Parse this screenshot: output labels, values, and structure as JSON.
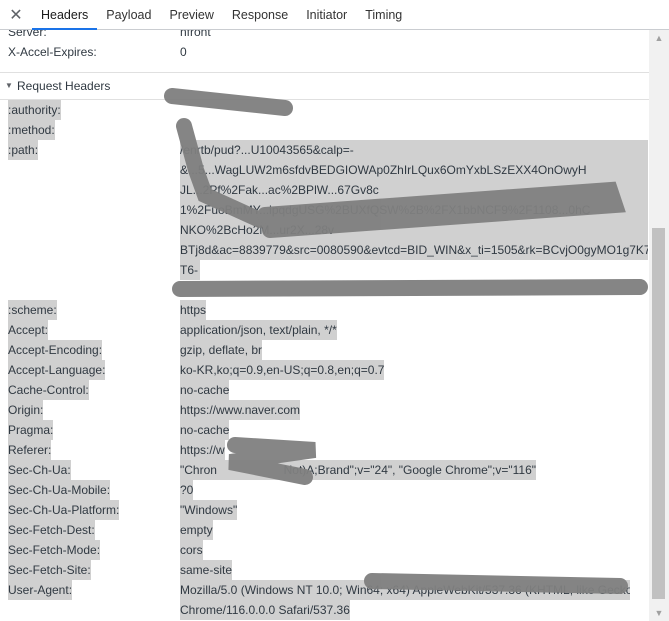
{
  "tabs": {
    "close": "✕",
    "items": [
      {
        "label": "Headers",
        "active": true
      },
      {
        "label": "Payload",
        "active": false
      },
      {
        "label": "Preview",
        "active": false
      },
      {
        "label": "Response",
        "active": false
      },
      {
        "label": "Initiator",
        "active": false
      },
      {
        "label": "Timing",
        "active": false
      }
    ]
  },
  "response_headers_tail": [
    {
      "name": "Server:",
      "value": "nfront"
    },
    {
      "name": "X-Accel-Expires:",
      "value": "0"
    }
  ],
  "request_section": {
    "title": "Request Headers",
    "toggle": "▼"
  },
  "request_headers": {
    "authority": {
      "name": ":authority:",
      "value": ""
    },
    "method": {
      "name": ":method:",
      "value": ""
    },
    "path": {
      "name": ":path:",
      "lines": [
        "/enrtb/pud?...U10043565&calp=-",
        "&...5...WagLUW2m6sfdvBEDGIOWAp0ZhIrLQux6OmYxbLSzEXX4OnOwyH",
        "JL...2Pf%2Fak...ac%2BPlW...67Gv8c",
        "1%2FuoBmMY...ipqdgUSG%2BUXfQSW%2B%2FX1bbNCF9%2F1108...0hC",
        "NKO%2BcHo2M...ur2X...28v",
        "BTj8d&ac=8839779&src=0080590&evtcd=BID_WIN&x_ti=1505&rk=BCvjO0gyMO1g7K7",
        "T6-"
      ]
    },
    "rows": [
      {
        "name": ":scheme:",
        "value": "https"
      },
      {
        "name": "Accept:",
        "value": "application/json, text/plain, */*"
      },
      {
        "name": "Accept-Encoding:",
        "value": "gzip, deflate, br"
      },
      {
        "name": "Accept-Language:",
        "value": "ko-KR,ko;q=0.9,en-US;q=0.8,en;q=0.7"
      },
      {
        "name": "Cache-Control:",
        "value": "no-cache"
      },
      {
        "name": "Origin:",
        "value": "https://www.naver.com"
      },
      {
        "name": "Pragma:",
        "value": "no-cache"
      },
      {
        "name": "Referer:",
        "value": "https://w"
      },
      {
        "name": "Sec-Ch-Ua:",
        "value": "\"Chron                    Not)A;Brand\";v=\"24\", \"Google Chrome\";v=\"116\""
      },
      {
        "name": "Sec-Ch-Ua-Mobile:",
        "value": "?0"
      },
      {
        "name": "Sec-Ch-Ua-Platform:",
        "value": "\"Windows\""
      },
      {
        "name": "Sec-Fetch-Dest:",
        "value": "empty"
      },
      {
        "name": "Sec-Fetch-Mode:",
        "value": "cors"
      },
      {
        "name": "Sec-Fetch-Site:",
        "value": "same-site"
      },
      {
        "name": "User-Agent:",
        "value": "Mozilla/5.0 (Windows NT 10.0; Win64; x64) AppleWebKit/537.36 (KHTML, like Gecko)"
      }
    ],
    "user_agent_line2": "Chrome/116.0.0.0 Safari/537.36"
  },
  "scrollbar": {
    "up": "▲",
    "down": "▼"
  }
}
